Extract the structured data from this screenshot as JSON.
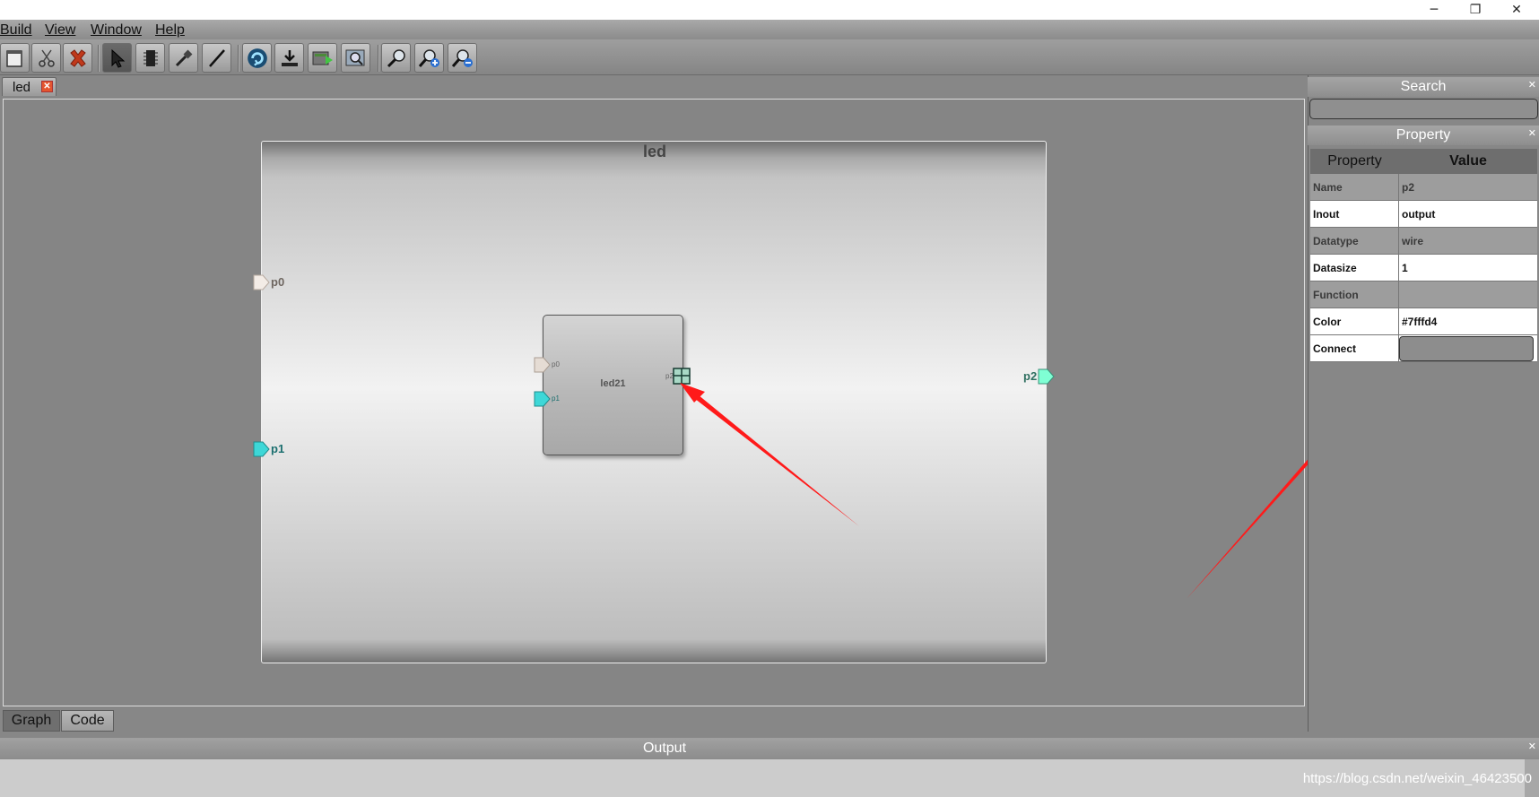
{
  "window": {
    "minimize_glyph": "─",
    "restore_glyph": "❐",
    "close_glyph": "✕"
  },
  "menu": {
    "items": [
      {
        "label": "Build"
      },
      {
        "label": "View"
      },
      {
        "label": "Window"
      },
      {
        "label": "Help"
      }
    ]
  },
  "toolbar": {
    "icons": [
      "new-file-icon",
      "cut-icon",
      "delete-icon",
      "select-pointer-icon",
      "chip-icon",
      "probe-icon",
      "wire-icon",
      "refresh-icon",
      "download-icon",
      "simulate-icon",
      "zoom-fit-icon",
      "magnifier-icon",
      "zoom-in-icon",
      "zoom-out-icon"
    ]
  },
  "document_tab": {
    "label": "led",
    "close_glyph": "✕"
  },
  "canvas": {
    "module": {
      "title": "led",
      "ports": {
        "p0": {
          "label": "p0",
          "color": "#f3ece6"
        },
        "p1": {
          "label": "p1",
          "color": "#3ed7d7"
        },
        "p2": {
          "label": "p2",
          "color": "#7fffd4"
        }
      }
    },
    "inner_block": {
      "title": "led21",
      "ports": {
        "p0": {
          "label": "p0"
        },
        "p1": {
          "label": "p1"
        },
        "p2": {
          "label": "p2"
        }
      }
    },
    "annotation_color": "#ff1a1a"
  },
  "view_tabs": {
    "graph": "Graph",
    "code": "Code",
    "active": "Graph"
  },
  "search_panel": {
    "title": "Search",
    "close_glyph": "✕",
    "value": ""
  },
  "property_panel": {
    "title": "Property",
    "close_glyph": "✕",
    "col_property": "Property",
    "col_value": "Value",
    "rows": [
      {
        "key": "Name",
        "value": "p2"
      },
      {
        "key": "Inout",
        "value": "output"
      },
      {
        "key": "Datatype",
        "value": "wire"
      },
      {
        "key": "Datasize",
        "value": "1"
      },
      {
        "key": "Function",
        "value": ""
      },
      {
        "key": "Color",
        "value": "#7fffd4"
      },
      {
        "key": "Connect",
        "value": ""
      }
    ]
  },
  "output_panel": {
    "title": "Output",
    "close_glyph": "✕"
  },
  "watermark": "https://blog.csdn.net/weixin_46423500"
}
